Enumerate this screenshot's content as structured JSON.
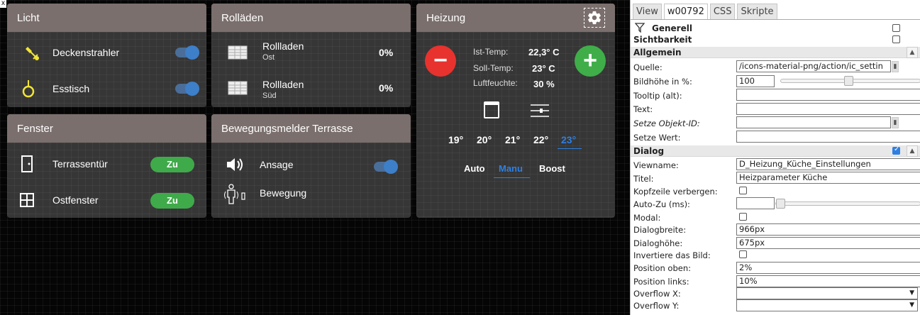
{
  "canvas": {
    "close_label": "x",
    "licht": {
      "title": "Licht",
      "rows": [
        {
          "label": "Deckenstrahler",
          "icon": "ceiling-spotlight-icon"
        },
        {
          "label": "Esstisch",
          "icon": "pendant-lamp-icon"
        }
      ]
    },
    "rolladen": {
      "title": "Rolläden",
      "rows": [
        {
          "label": "Rollladen",
          "sub": "Ost",
          "value": "0%"
        },
        {
          "label": "Rollladen",
          "sub": "Süd",
          "value": "0%"
        }
      ]
    },
    "heizung": {
      "title": "Heizung",
      "ist_label": "Ist-Temp:",
      "ist_value": "22,3° C",
      "soll_label": "Soll-Temp:",
      "soll_value": "23° C",
      "feuchte_label": "Luftfeuchte:",
      "feuchte_value": "30 %",
      "minus": "−",
      "plus": "+",
      "temps": [
        "19°",
        "20°",
        "21°",
        "22°",
        "23°"
      ],
      "active_temp_index": 4,
      "modes": [
        "Auto",
        "Manu",
        "Boost"
      ],
      "active_mode_index": 1
    },
    "fenster": {
      "title": "Fenster",
      "rows": [
        {
          "label": "Terrassentür",
          "state": "Zu"
        },
        {
          "label": "Ostfenster",
          "state": "Zu"
        }
      ]
    },
    "bewegung": {
      "title": "Bewegungsmelder Terrasse",
      "rows": [
        {
          "label": "Ansage"
        },
        {
          "label": "Bewegung"
        }
      ]
    }
  },
  "editor": {
    "tabs": [
      "View",
      "w00792",
      "CSS",
      "Skripte"
    ],
    "active_tab": "w00792",
    "sections": {
      "generell": "Generell",
      "sichtbarkeit": "Sichtbarkeit",
      "allgemein": "Allgemein",
      "dialog": "Dialog"
    },
    "props": {
      "quelle_label": "Quelle:",
      "quelle_value": "/icons-material-png/action/ic_settin",
      "bildhoehe_label": "Bildhöhe in %:",
      "bildhoehe_value": "100",
      "tooltip_label": "Tooltip (alt):",
      "text_label": "Text:",
      "objekt_label": "Setze Objekt-ID:",
      "wert_label": "Setze Wert:",
      "viewname_label": "Viewname:",
      "viewname_value": "D_Heizung_Küche_Einstellungen",
      "titel_label": "Titel:",
      "titel_value": "Heizparameter Küche",
      "kopfzeile_label": "Kopfzeile verbergen:",
      "autozu_label": "Auto-Zu (ms):",
      "modal_label": "Modal:",
      "breite_label": "Dialogbreite:",
      "breite_value": "966px",
      "hoehe_label": "Dialoghöhe:",
      "hoehe_value": "675px",
      "invert_label": "Invertiere das Bild:",
      "oben_label": "Position oben:",
      "oben_value": "2%",
      "links_label": "Position links:",
      "links_value": "10%",
      "overflowx_label": "Overflow X:",
      "overflowy_label": "Overflow Y:"
    }
  }
}
